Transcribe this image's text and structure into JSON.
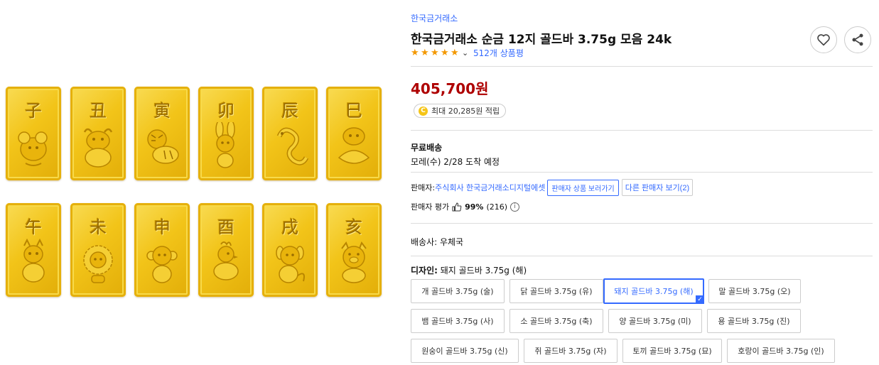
{
  "gallery": {
    "bars": [
      {
        "glyph": "子",
        "animal": "mouse"
      },
      {
        "glyph": "丑",
        "animal": "ox"
      },
      {
        "glyph": "寅",
        "animal": "tiger"
      },
      {
        "glyph": "卯",
        "animal": "rabbit"
      },
      {
        "glyph": "辰",
        "animal": "dragon"
      },
      {
        "glyph": "巳",
        "animal": "snake"
      },
      {
        "glyph": "午",
        "animal": "horse"
      },
      {
        "glyph": "未",
        "animal": "sheep"
      },
      {
        "glyph": "申",
        "animal": "monkey"
      },
      {
        "glyph": "酉",
        "animal": "rooster"
      },
      {
        "glyph": "戌",
        "animal": "dog"
      },
      {
        "glyph": "亥",
        "animal": "pig"
      }
    ]
  },
  "product": {
    "brand": "한국금거래소",
    "title": "한국금거래소 순금 12지 골드바 3.75g 모음 24k",
    "rating_stars": 5,
    "review_count": "512개 상품평",
    "price": "405,700원",
    "cashback": "최대 20,285원 적립",
    "coin_letter": "C"
  },
  "shipping": {
    "label": "무료배송",
    "arrival": "모레(수) 2/28 도착 예정"
  },
  "seller": {
    "prefix": "판매자: ",
    "name": "주식회사 한국금거래소디지털에셋",
    "view_products_button": "판매자 상품 보러가기",
    "other_sellers_button": "다른 판매자 보기(2)",
    "eval_label": "판매자 평가",
    "eval_percent": "99%",
    "eval_count": "(216)"
  },
  "courier": "배송사: 우체국",
  "design": {
    "label": "디자인:",
    "selected": " 돼지 골드바 3.75g (해)",
    "options": [
      {
        "label": "개 골드바 3.75g (술)",
        "selected": false
      },
      {
        "label": "닭 골드바 3.75g (유)",
        "selected": false
      },
      {
        "label": "돼지 골드바 3.75g (해)",
        "selected": true
      },
      {
        "label": "말 골드바 3.75g (오)",
        "selected": false
      },
      {
        "label": "뱀 골드바 3.75g (사)",
        "selected": false
      },
      {
        "label": "소 골드바 3.75g (축)",
        "selected": false
      },
      {
        "label": "양 골드바 3.75g (미)",
        "selected": false
      },
      {
        "label": "용 골드바 3.75g (진)",
        "selected": false
      },
      {
        "label": "원숭이 골드바 3.75g (신)",
        "selected": false
      },
      {
        "label": "쥐 골드바 3.75g (자)",
        "selected": false
      },
      {
        "label": "토끼 골드바 3.75g (묘)",
        "selected": false
      },
      {
        "label": "호랑이 골드바 3.75g (인)",
        "selected": false
      }
    ]
  },
  "icons": {
    "heart": "heart-icon",
    "share": "share-icon",
    "thumb": "thumbs-up-icon",
    "info": "info-icon",
    "check": "check-icon"
  },
  "colors": {
    "link": "#346aff",
    "price": "#ae0000",
    "star": "#f39800",
    "gold": "#f2c419"
  }
}
